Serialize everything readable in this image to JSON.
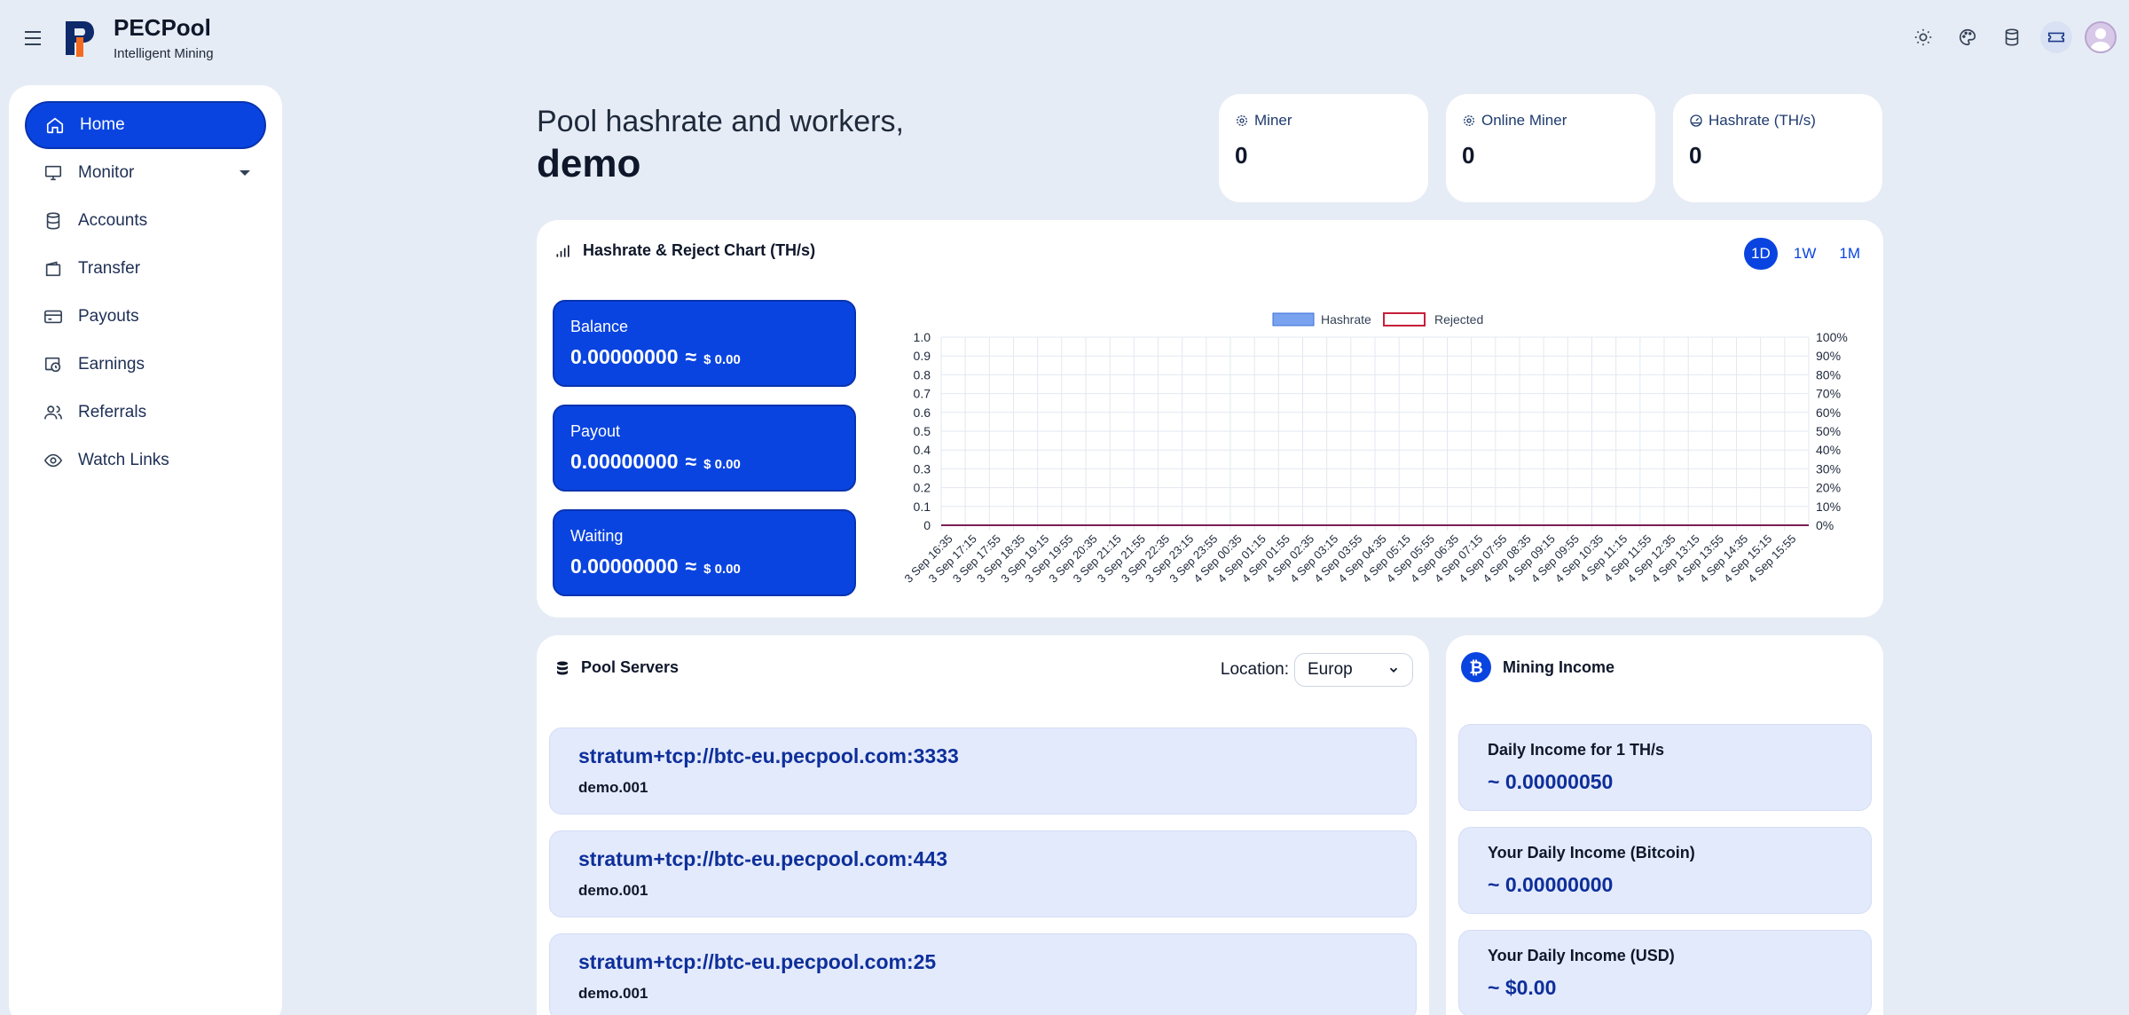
{
  "app": {
    "name": "PECPool",
    "subtitle": "Intelligent Mining"
  },
  "top_icons": [
    "sun-icon",
    "palette-icon",
    "database-icon",
    "ticket-icon",
    "avatar"
  ],
  "sidebar": {
    "items": [
      {
        "label": "Home",
        "icon": "home-icon",
        "active": true
      },
      {
        "label": "Monitor",
        "icon": "monitor-icon",
        "has_dropdown": true
      },
      {
        "label": "Accounts",
        "icon": "database-icon"
      },
      {
        "label": "Transfer",
        "icon": "wallet-icon"
      },
      {
        "label": "Payouts",
        "icon": "credit-card-icon"
      },
      {
        "label": "Earnings",
        "icon": "clock-money-icon"
      },
      {
        "label": "Referrals",
        "icon": "users-icon"
      },
      {
        "label": "Watch Links",
        "icon": "eye-icon"
      }
    ]
  },
  "greeting": {
    "line1": "Pool hashrate and workers,",
    "user": "demo"
  },
  "stats": [
    {
      "title": "Miner",
      "value": "0"
    },
    {
      "title": "Online Miner",
      "value": "0"
    },
    {
      "title": "Hashrate (TH/s)",
      "value": "0"
    }
  ],
  "chart_panel": {
    "title": "Hashrate & Reject Chart (TH/s)",
    "ranges": [
      "1D",
      "1W",
      "1M"
    ],
    "active_range": "1D",
    "balances": [
      {
        "label": "Balance",
        "amount": "0.00000000",
        "approx": "≈",
        "usd": "$ 0.00"
      },
      {
        "label": "Payout",
        "amount": "0.00000000",
        "approx": "≈",
        "usd": "$ 0.00"
      },
      {
        "label": "Waiting",
        "amount": "0.00000000",
        "approx": "≈",
        "usd": "$ 0.00"
      }
    ]
  },
  "chart_data": {
    "type": "bar",
    "title": "",
    "xlabel": "",
    "ylabel": "",
    "ylim": [
      0,
      1.0
    ],
    "y2lim": [
      0,
      100
    ],
    "y_ticks": [
      "0",
      "0.1",
      "0.2",
      "0.3",
      "0.4",
      "0.5",
      "0.6",
      "0.7",
      "0.8",
      "0.9",
      "1.0"
    ],
    "y2_ticks": [
      "0%",
      "10%",
      "20%",
      "30%",
      "40%",
      "50%",
      "60%",
      "70%",
      "80%",
      "90%",
      "100%"
    ],
    "grid": true,
    "legend_position": "top",
    "categories": [
      "3 Sep 16:35",
      "3 Sep 17:15",
      "3 Sep 17:55",
      "3 Sep 18:35",
      "3 Sep 19:15",
      "3 Sep 19:55",
      "3 Sep 20:35",
      "3 Sep 21:15",
      "3 Sep 21:55",
      "3 Sep 22:35",
      "3 Sep 23:15",
      "3 Sep 23:55",
      "4 Sep 00:35",
      "4 Sep 01:15",
      "4 Sep 01:55",
      "4 Sep 02:35",
      "4 Sep 03:15",
      "4 Sep 03:55",
      "4 Sep 04:35",
      "4 Sep 05:15",
      "4 Sep 05:55",
      "4 Sep 06:35",
      "4 Sep 07:15",
      "4 Sep 07:55",
      "4 Sep 08:35",
      "4 Sep 09:15",
      "4 Sep 09:55",
      "4 Sep 10:35",
      "4 Sep 11:15",
      "4 Sep 11:55",
      "4 Sep 12:35",
      "4 Sep 13:15",
      "4 Sep 13:55",
      "4 Sep 14:35",
      "4 Sep 15:15",
      "4 Sep 15:55"
    ],
    "series": [
      {
        "name": "Hashrate",
        "type": "bar",
        "color": "#7aa3ef",
        "values": [
          0,
          0,
          0,
          0,
          0,
          0,
          0,
          0,
          0,
          0,
          0,
          0,
          0,
          0,
          0,
          0,
          0,
          0,
          0,
          0,
          0,
          0,
          0,
          0,
          0,
          0,
          0,
          0,
          0,
          0,
          0,
          0,
          0,
          0,
          0,
          0
        ]
      },
      {
        "name": "Rejected",
        "type": "line",
        "color": "#c81e3a",
        "values": [
          0,
          0,
          0,
          0,
          0,
          0,
          0,
          0,
          0,
          0,
          0,
          0,
          0,
          0,
          0,
          0,
          0,
          0,
          0,
          0,
          0,
          0,
          0,
          0,
          0,
          0,
          0,
          0,
          0,
          0,
          0,
          0,
          0,
          0,
          0,
          0
        ]
      }
    ]
  },
  "servers_panel": {
    "title": "Pool Servers",
    "location_label": "Location:",
    "location_value": "Europ",
    "servers": [
      {
        "url": "stratum+tcp://btc-eu.pecpool.com:3333",
        "user": "demo.001"
      },
      {
        "url": "stratum+tcp://btc-eu.pecpool.com:443",
        "user": "demo.001"
      },
      {
        "url": "stratum+tcp://btc-eu.pecpool.com:25",
        "user": "demo.001"
      }
    ]
  },
  "income_panel": {
    "title": "Mining Income",
    "items": [
      {
        "label": "Daily Income for 1 TH/s",
        "value": "~ 0.00000050"
      },
      {
        "label": "Your Daily Income (Bitcoin)",
        "value": "~ 0.00000000"
      },
      {
        "label": "Your Daily Income (USD)",
        "value": "~ $0.00"
      }
    ]
  },
  "colors": {
    "accent": "#0a44e0",
    "background": "#e6ecf5",
    "card": "#ffffff",
    "server_bg": "#e3eafc",
    "link": "#0e2f9a"
  }
}
